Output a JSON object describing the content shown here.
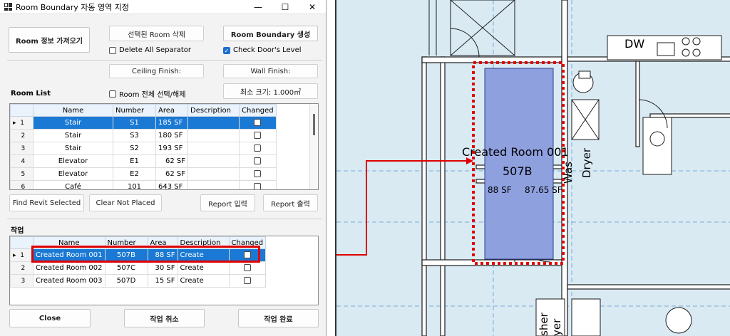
{
  "window": {
    "title": "Room Boundary 자동 영역 지정",
    "min_icon": "—",
    "max_icon": "☐",
    "close_icon": "✕"
  },
  "top_buttons": {
    "get_room": "Room 정보 가져오기",
    "delete_room": "선택된 Room 삭제",
    "create_boundary": "Room  Boundary 생성",
    "ceiling_finish": "Ceiling Finish:",
    "wall_finish": "Wall Finish:",
    "min_size": "최소 크기: 1.000㎡"
  },
  "checks": {
    "delete_all_separator": "Delete All Separator",
    "check_door_level": "Check Door's Level",
    "room_select_all": "Room 전체 선택/해제"
  },
  "room_list": {
    "label": "Room List",
    "columns": [
      "Name",
      "Number",
      "Area",
      "Description",
      "Changed"
    ],
    "rows": [
      {
        "idx": "1",
        "name": "Stair",
        "number": "S1",
        "area": "185 SF",
        "desc": "",
        "marker": "▸"
      },
      {
        "idx": "2",
        "name": "Stair",
        "number": "S3",
        "area": "180 SF",
        "desc": "",
        "marker": ""
      },
      {
        "idx": "3",
        "name": "Stair",
        "number": "S2",
        "area": "193 SF",
        "desc": "",
        "marker": ""
      },
      {
        "idx": "4",
        "name": "Elevator",
        "number": "E1",
        "area": "62 SF",
        "desc": "",
        "marker": ""
      },
      {
        "idx": "5",
        "name": "Elevator",
        "number": "E2",
        "area": "62 SF",
        "desc": "",
        "marker": ""
      },
      {
        "idx": "6",
        "name": "Café",
        "number": "101",
        "area": "643 SF",
        "desc": "",
        "marker": ""
      }
    ]
  },
  "mid_buttons": {
    "find_revit": "Find Revit Selected",
    "clear_not_placed": "Clear Not Placed",
    "report_input": "Report 입력",
    "report_output": "Report 출력"
  },
  "work_list": {
    "label": "작업",
    "columns": [
      "Name",
      "Number",
      "Area",
      "Description",
      "Changed"
    ],
    "rows": [
      {
        "idx": "1",
        "name": "Created Room 001",
        "number": "507B",
        "area": "88 SF",
        "desc": "Create",
        "marker": "▸"
      },
      {
        "idx": "2",
        "name": "Created Room 002",
        "number": "507C",
        "area": "30 SF",
        "desc": "Create",
        "marker": ""
      },
      {
        "idx": "3",
        "name": "Created Room 003",
        "number": "507D",
        "area": "15 SF",
        "desc": "Create",
        "marker": ""
      }
    ]
  },
  "bottom_buttons": {
    "close": "Close",
    "cancel": "작업 취소",
    "complete": "작업 완료"
  },
  "drawing": {
    "room_name": "Created Room 001",
    "room_number": "507B",
    "area_1": "88 SF",
    "area_2": "87.65 SF",
    "tag_dw": "DW",
    "tag_washer_top": "Was",
    "tag_dryer": "Dryer",
    "tag_washer_bottom": "sher",
    "tag_dryer_bottom": "yer"
  },
  "colors": {
    "accent": "#1a79d4",
    "highlight": "#e00000",
    "plan_bg": "#d9eaf3",
    "room_fill": "#8fa0df"
  }
}
